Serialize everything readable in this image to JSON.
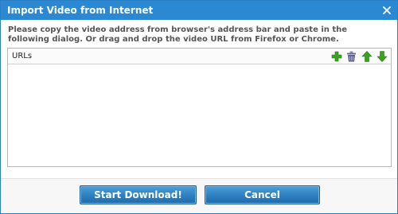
{
  "dialog": {
    "title": "Import Video from Internet",
    "close_icon": "close-icon",
    "instructions": "Please copy the video address from browser's address bar and paste in the following dialog. Or drag and drop the video URL from Firefox or Chrome."
  },
  "list": {
    "column_header": "URLs",
    "rows": [],
    "toolbar": [
      {
        "name": "add-icon",
        "color": "#3aa020"
      },
      {
        "name": "trash-icon",
        "color": "#5a5f8a"
      },
      {
        "name": "move-up-icon",
        "color": "#3aa020"
      },
      {
        "name": "move-down-icon",
        "color": "#3aa020"
      }
    ]
  },
  "buttons": {
    "start_label": "Start Download!",
    "cancel_label": "Cancel"
  },
  "colors": {
    "titlebar": "#2b89d4",
    "button": "#2d7fbf",
    "accent_green": "#3aa020"
  }
}
